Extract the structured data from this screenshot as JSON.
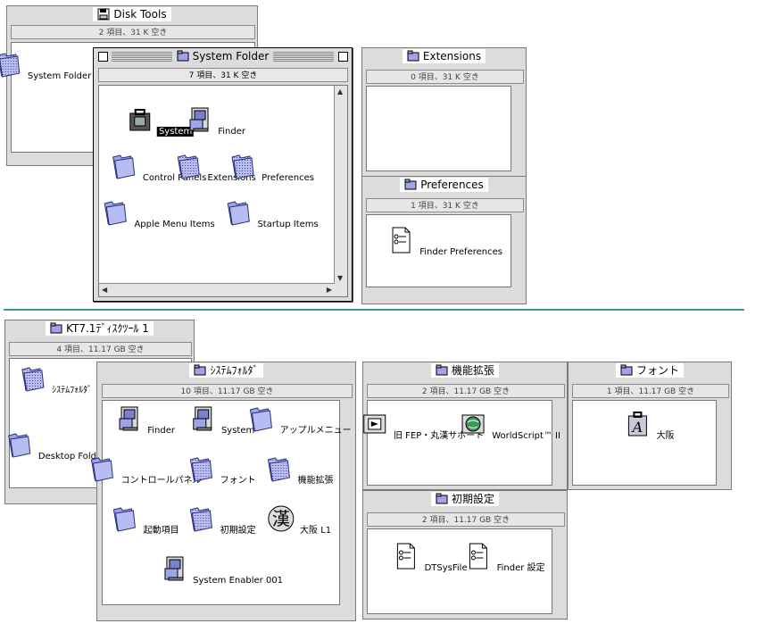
{
  "windows": {
    "disk_tools": {
      "title": "Disk Tools",
      "info": "2 項目、31 K 空き",
      "icons": [
        "System Folder"
      ]
    },
    "system_folder": {
      "title": "System Folder",
      "info": "7 項目、31 K 空き",
      "icons": [
        "System",
        "Finder",
        "Control Panels",
        "Extensions",
        "Preferences",
        "Apple Menu Items",
        "Startup Items"
      ]
    },
    "extensions": {
      "title": "Extensions",
      "info": "0 項目、31 K 空き"
    },
    "preferences": {
      "title": "Preferences",
      "info": "1 項目、31 K 空き",
      "icons": [
        "Finder Preferences"
      ]
    },
    "kt71": {
      "title": "KT7.1ﾃﾞｨｽｸﾂｰﾙ 1",
      "info": "4 項目、11.17 GB 空き",
      "icons": [
        "ｼｽﾃﾑﾌｫﾙﾀﾞ",
        "Desktop Folder"
      ]
    },
    "jp_system": {
      "title": "ｼｽﾃﾑﾌｫﾙﾀﾞ",
      "info": "10 項目、11.17 GB 空き",
      "icons": [
        "Finder",
        "System",
        "アップルメニュー",
        "コントロールパネル",
        "フォント",
        "機能拡張",
        "起動項目",
        "初期設定",
        "大阪 L1",
        "System Enabler 001"
      ]
    },
    "kino": {
      "title": "機能拡張",
      "info": "2 項目、11.17 GB 空き",
      "icons": [
        "旧 FEP・丸漢サポート",
        "WorldScript™ II"
      ]
    },
    "font": {
      "title": "フォント",
      "info": "1 項目、11.17 GB 空き",
      "icons": [
        "大阪"
      ]
    },
    "shoki": {
      "title": "初期設定",
      "info": "2 項目、11.17 GB 空き",
      "icons": [
        "DTSysFile",
        "Finder 設定"
      ]
    }
  },
  "glyphs": {
    "kanji_font": "漢"
  },
  "colors": {
    "divider": "#3a9a98",
    "folder": "#9da4e8",
    "selection": "#000000"
  }
}
